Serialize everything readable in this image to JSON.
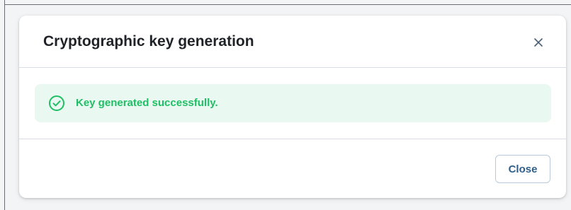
{
  "modal": {
    "title": "Cryptographic key generation"
  },
  "alert": {
    "message": "Key generated successfully.",
    "icon": "check-circle-icon",
    "color": "#1fbf66",
    "background": "#e9f8f0"
  },
  "footer": {
    "close_label": "Close"
  },
  "icons": {
    "dismiss": "close-icon"
  }
}
